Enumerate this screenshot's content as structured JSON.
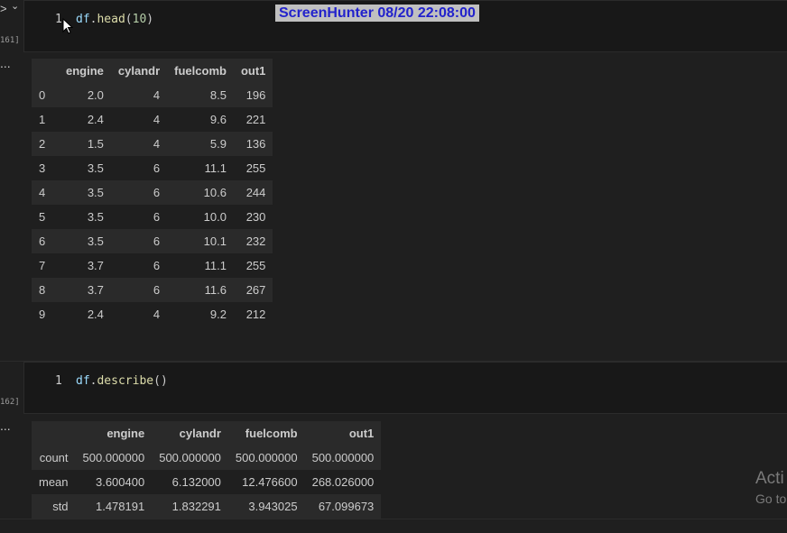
{
  "cell1": {
    "exec_count": "161]",
    "line_number": "1",
    "code": {
      "var": "df",
      "dot": ".",
      "fn": "head",
      "open": "(",
      "arg": "10",
      "close": ")"
    }
  },
  "table1": {
    "columns": [
      "engine",
      "cylandr",
      "fuelcomb",
      "out1"
    ],
    "rows": [
      {
        "index": "0",
        "cells": [
          "2.0",
          "4",
          "8.5",
          "196"
        ]
      },
      {
        "index": "1",
        "cells": [
          "2.4",
          "4",
          "9.6",
          "221"
        ]
      },
      {
        "index": "2",
        "cells": [
          "1.5",
          "4",
          "5.9",
          "136"
        ]
      },
      {
        "index": "3",
        "cells": [
          "3.5",
          "6",
          "11.1",
          "255"
        ]
      },
      {
        "index": "4",
        "cells": [
          "3.5",
          "6",
          "10.6",
          "244"
        ]
      },
      {
        "index": "5",
        "cells": [
          "3.5",
          "6",
          "10.0",
          "230"
        ]
      },
      {
        "index": "6",
        "cells": [
          "3.5",
          "6",
          "10.1",
          "232"
        ]
      },
      {
        "index": "7",
        "cells": [
          "3.7",
          "6",
          "11.1",
          "255"
        ]
      },
      {
        "index": "8",
        "cells": [
          "3.7",
          "6",
          "11.6",
          "267"
        ]
      },
      {
        "index": "9",
        "cells": [
          "2.4",
          "4",
          "9.2",
          "212"
        ]
      }
    ]
  },
  "cell2": {
    "exec_count": "162]",
    "line_number": "1",
    "code": {
      "var": "df",
      "dot": ".",
      "fn": "describe",
      "open": "(",
      "arg": "",
      "close": ")"
    }
  },
  "table2": {
    "columns": [
      "engine",
      "cylandr",
      "fuelcomb",
      "out1"
    ],
    "rows": [
      {
        "index": "count",
        "cells": [
          "500.000000",
          "500.000000",
          "500.000000",
          "500.000000"
        ]
      },
      {
        "index": "mean",
        "cells": [
          "3.600400",
          "6.132000",
          "12.476600",
          "268.026000"
        ]
      },
      {
        "index": "std",
        "cells": [
          "1.478191",
          "1.832291",
          "3.943025",
          "67.099673"
        ]
      }
    ]
  },
  "watermark": "ScreenHunter  08/20  22:08:00",
  "activate": {
    "line1": "Acti",
    "line2": "Go to"
  },
  "gutter": {
    "run_glyph": ">",
    "chevron_glyph": "⌄",
    "dots": "..."
  },
  "colors": {
    "background": "#1f1f1f",
    "cell_background": "#181818",
    "watermark_text": "#2222cc"
  }
}
